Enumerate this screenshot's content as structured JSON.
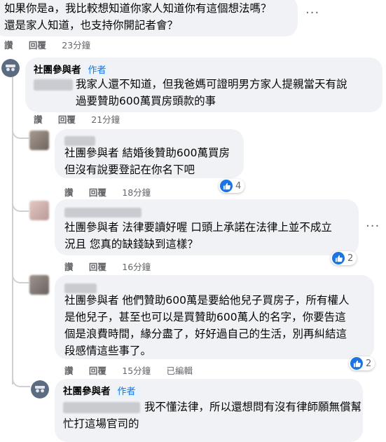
{
  "comments": [
    {
      "text": "如果你是a，我比較想知道你家人知道你有這個想法嗎？\n還是家人知道，也支持你開記者會？",
      "actions": {
        "like": "讚",
        "reply": "回覆",
        "time": "23分鐘"
      }
    },
    {
      "author": "社團參與者",
      "badge": "作者",
      "text": "我家人還不知道，但我爸媽可證明男方家人提親當天有說\n過要贊助600萬買房頭款的事",
      "actions": {
        "like": "讚",
        "reply": "回覆",
        "time": "21分鐘"
      }
    },
    {
      "text": "社團參與者 結婚後贊助600萬買房\n但沒有說要登記在你名下吧",
      "actions": {
        "like": "讚",
        "reply": "回覆",
        "time": "18分鐘"
      },
      "reactions": "4"
    },
    {
      "text": "社團參與者 法律要讀好喔 口頭上承諾在法律上並不成立\n況且 您真的缺錢缺到這樣？",
      "actions": {
        "like": "讚",
        "reply": "回覆",
        "time": "16分鐘"
      },
      "reactions": "2"
    },
    {
      "text": "社團參與者 他們贊助600萬是要給他兒子買房子，所有權人\n是他兒子，甚至也可以是買贊助600萬人的名字，你要告這\n個是浪費時間，緣分盡了，好好過自己的生活，別再糾結這\n段感情這些事了。",
      "actions": {
        "like": "讚",
        "reply": "回覆",
        "time": "15分鐘",
        "edited": "已編輯"
      },
      "reactions": "2"
    },
    {
      "author": "社團參與者",
      "badge": "作者",
      "text": "我不懂法律，所以還想問有沒有律師願無償幫\n忙打這場官司的"
    }
  ],
  "colors": {
    "bubble": "#f0f2f5",
    "link": "#1b74e4",
    "meta": "#65676b"
  },
  "icons": [
    "more-dots-icon",
    "anonymous-avatar-icon",
    "like-thumb-icon"
  ]
}
